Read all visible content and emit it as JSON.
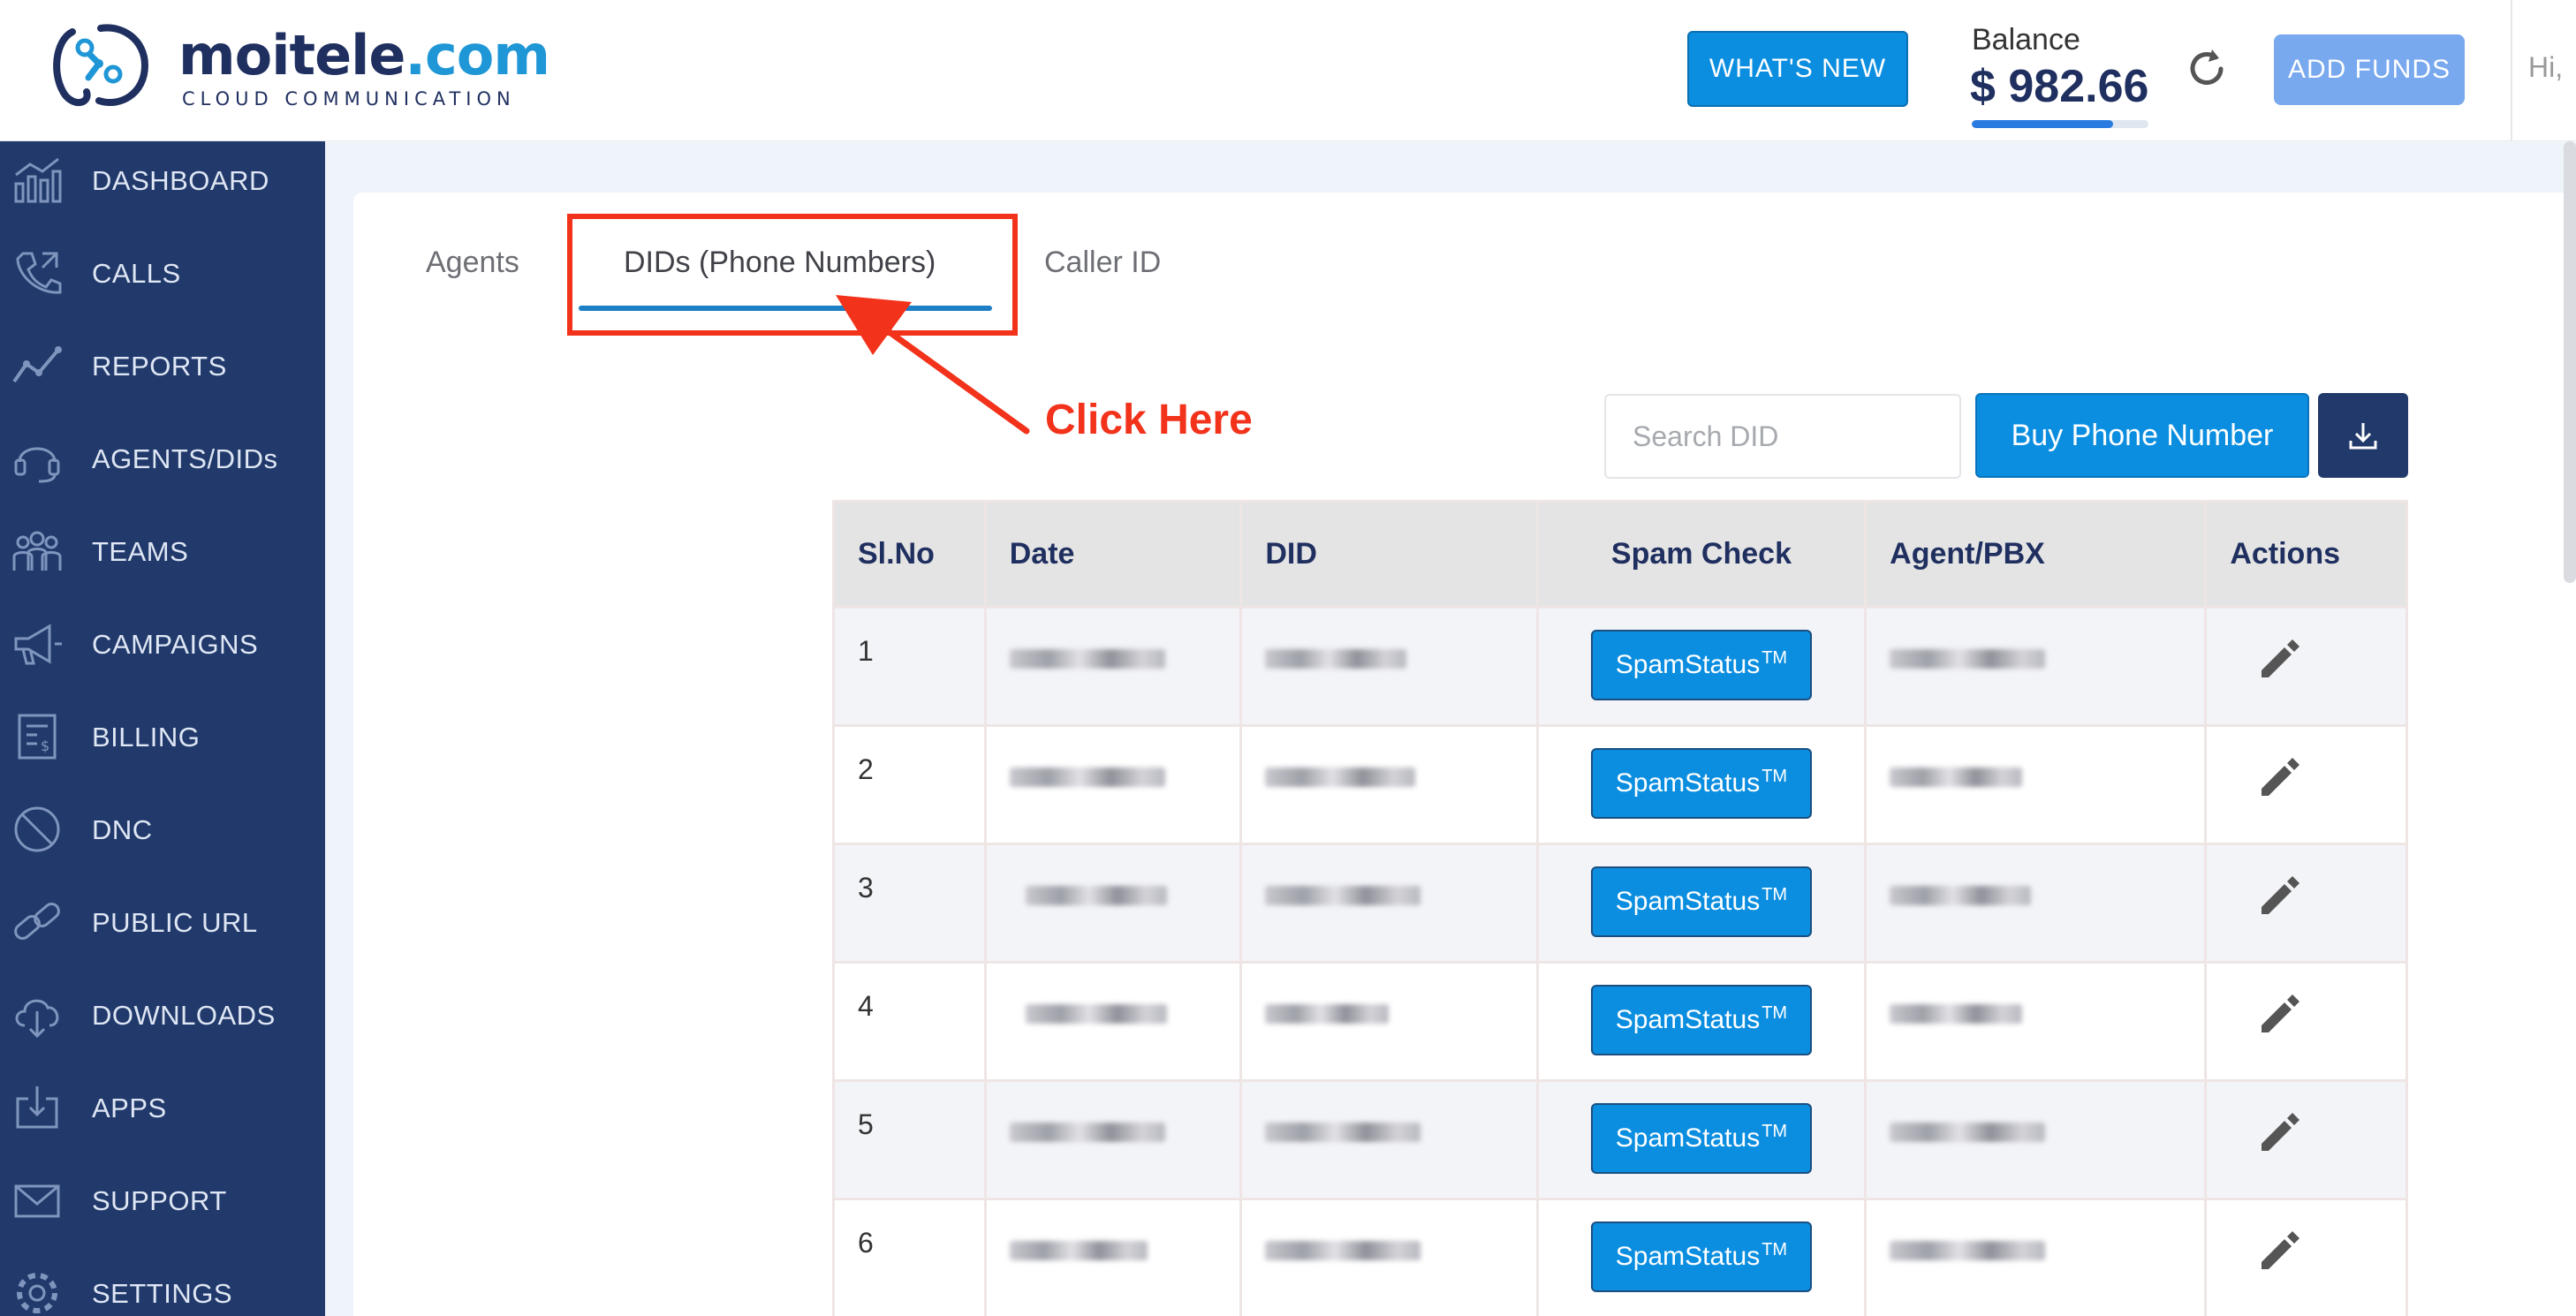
{
  "header": {
    "brand": "moitele",
    "brand_suffix": ".com",
    "brand_subtitle": "CLOUD COMMUNICATION",
    "whats_new_label": "WHAT'S NEW",
    "balance_label": "Balance",
    "balance_value": "$ 982.66",
    "add_funds_label": "ADD FUNDS",
    "greeting": "Hi,"
  },
  "sidebar": {
    "items": [
      {
        "label": "DASHBOARD",
        "icon": "dashboard-icon"
      },
      {
        "label": "CALLS",
        "icon": "phone-icon"
      },
      {
        "label": "REPORTS",
        "icon": "chart-icon"
      },
      {
        "label": "AGENTS/DIDs",
        "icon": "headset-icon"
      },
      {
        "label": "TEAMS",
        "icon": "team-icon"
      },
      {
        "label": "CAMPAIGNS",
        "icon": "megaphone-icon"
      },
      {
        "label": "BILLING",
        "icon": "invoice-icon"
      },
      {
        "label": "DNC",
        "icon": "block-icon"
      },
      {
        "label": "PUBLIC URL",
        "icon": "link-icon"
      },
      {
        "label": "DOWNLOADS",
        "icon": "cloud-download-icon"
      },
      {
        "label": "APPS",
        "icon": "app-download-icon"
      },
      {
        "label": "SUPPORT",
        "icon": "mail-icon"
      },
      {
        "label": "SETTINGS",
        "icon": "settings-icon"
      }
    ]
  },
  "tabs": {
    "agents": "Agents",
    "dids": "DIDs (Phone Numbers)",
    "caller_id": "Caller ID"
  },
  "annotation": {
    "click_here": "Click Here"
  },
  "toolbar": {
    "search_placeholder": "Search DID",
    "buy_label": "Buy Phone Number"
  },
  "table": {
    "headers": {
      "slno": "Sl.No",
      "date": "Date",
      "did": "DID",
      "spam": "Spam Check",
      "agent": "Agent/PBX",
      "actions": "Actions"
    },
    "spam_label": "SpamStatus",
    "spam_tm": "TM",
    "rows": [
      {
        "slno": "1"
      },
      {
        "slno": "2"
      },
      {
        "slno": "3"
      },
      {
        "slno": "4"
      },
      {
        "slno": "5"
      },
      {
        "slno": "6"
      }
    ]
  },
  "colors": {
    "sidebar": "#213a6b",
    "primary": "#0b8ee0",
    "annotation": "#f2321b"
  }
}
